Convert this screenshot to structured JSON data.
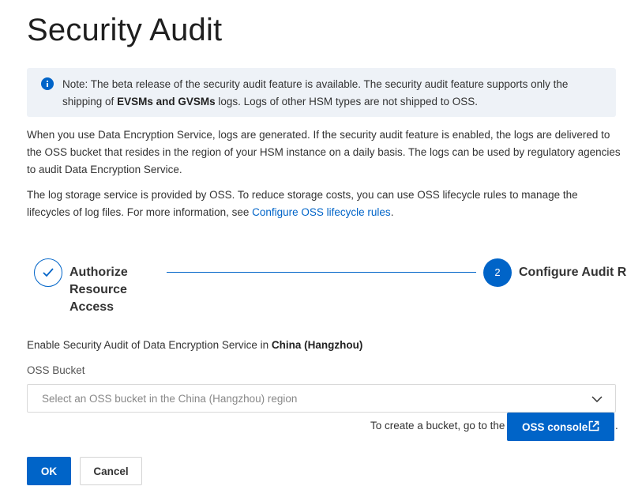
{
  "page": {
    "title": "Security Audit"
  },
  "note": {
    "prefix": "Note: The beta release of the security audit feature is available. The security audit feature supports only the shipping of ",
    "bold": "EVSMs and GVSMs",
    "suffix": " logs. Logs of other HSM types are not shipped to OSS."
  },
  "paragraphs": {
    "p1": "When you use Data Encryption Service, logs are generated. If the security audit feature is enabled, the logs are delivered to the OSS bucket that resides in the region of your HSM instance on a daily basis. The logs can be used by regulatory agencies to audit Data Encryption Service.",
    "p2_text": "The log storage service is provided by OSS. To reduce storage costs, you can use OSS lifecycle rules to manage the lifecycles of log files. For more information, see ",
    "p2_link": "Configure OSS lifecycle rules",
    "p2_end": "."
  },
  "steps": [
    {
      "label": "Authorize Resource Access",
      "state": "done"
    },
    {
      "number": "2",
      "label": "Configure Audit Rule",
      "state": "active"
    }
  ],
  "form": {
    "region_prefix": "Enable Security Audit of Data Encryption Service in ",
    "region_bold": "China (Hangzhou)",
    "bucket_label": "OSS Bucket",
    "bucket_placeholder": "Select an OSS bucket in the China (Hangzhou) region",
    "hint": "To create a bucket, go to the",
    "console_button": "OSS console",
    "hint_end": "."
  },
  "actions": {
    "ok": "OK",
    "cancel": "Cancel"
  },
  "colors": {
    "accent": "#0064c8",
    "note_background": "#eef2f7"
  },
  "icons": {
    "note": "info-icon",
    "done_step": "check-icon",
    "dropdown": "chevron-down-icon",
    "external": "external-link-icon"
  }
}
